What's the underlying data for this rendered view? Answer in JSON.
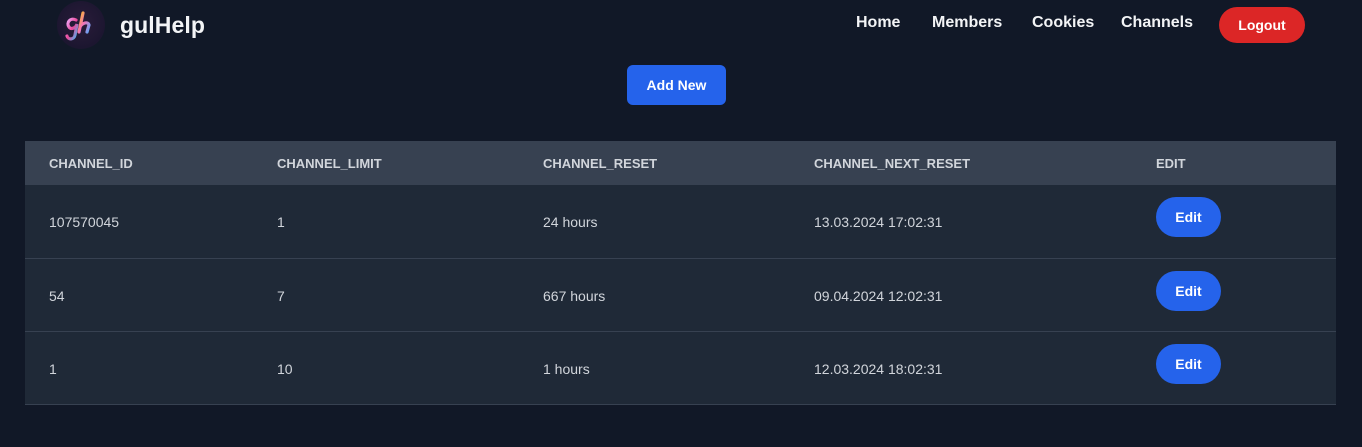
{
  "brand": {
    "name": "gulHelp",
    "logo_icon": "gh-logo-icon"
  },
  "nav": {
    "items": [
      {
        "label": "Home"
      },
      {
        "label": "Members"
      },
      {
        "label": "Cookies"
      },
      {
        "label": "Channels"
      }
    ],
    "logout_label": "Logout"
  },
  "actions": {
    "add_new_label": "Add New"
  },
  "colors": {
    "background": "#111827",
    "primary": "#2563eb",
    "danger": "#dc2626",
    "table_header": "#374151",
    "table_row": "#1f2937"
  },
  "table": {
    "headers": [
      "CHANNEL_ID",
      "CHANNEL_LIMIT",
      "CHANNEL_RESET",
      "CHANNEL_NEXT_RESET",
      "EDIT"
    ],
    "rows": [
      {
        "channel_id": "107570045",
        "channel_limit": "1",
        "channel_reset": "24 hours",
        "channel_next_reset": "13.03.2024 17:02:31",
        "edit_label": "Edit"
      },
      {
        "channel_id": "54",
        "channel_limit": "7",
        "channel_reset": "667 hours",
        "channel_next_reset": "09.04.2024 12:02:31",
        "edit_label": "Edit"
      },
      {
        "channel_id": "1",
        "channel_limit": "10",
        "channel_reset": "1 hours",
        "channel_next_reset": "12.03.2024 18:02:31",
        "edit_label": "Edit"
      }
    ]
  }
}
